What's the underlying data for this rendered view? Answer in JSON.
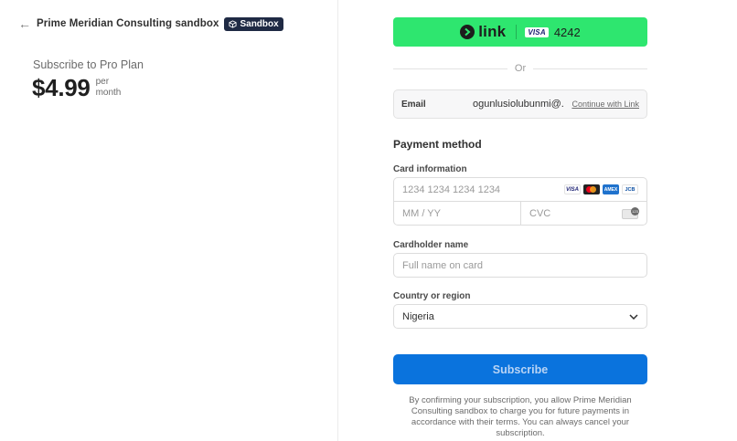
{
  "header": {
    "back_glyph": "←",
    "merchant_name": "Prime Meridian Consulting sandbox",
    "badge_label": "Sandbox"
  },
  "summary": {
    "title": "Subscribe to Pro Plan",
    "price": "$4.99",
    "per_line1": "per",
    "per_line2": "month"
  },
  "link_button": {
    "logo_text": "link",
    "card_brand": "VISA",
    "last4": "4242",
    "color": "#2ee66f"
  },
  "divider": {
    "text": "Or"
  },
  "email": {
    "label": "Email",
    "value": "ogunlusiolubunmi@...",
    "action": "Continue with Link"
  },
  "payment": {
    "section_title": "Payment method",
    "card_label": "Card information",
    "card_number_placeholder": "1234 1234 1234 1234",
    "expiry_placeholder": "MM / YY",
    "cvc_placeholder": "CVC",
    "brands": [
      "VISA",
      "Mastercard",
      "AMEX",
      "JCB"
    ],
    "cardholder_label": "Cardholder name",
    "cardholder_placeholder": "Full name on card",
    "country_label": "Country or region",
    "country_value": "Nigeria"
  },
  "submit": {
    "label": "Subscribe",
    "color": "#0a73dd"
  },
  "consent": {
    "text": "By confirming your subscription, you allow Prime Meridian Consulting sandbox to charge you for future payments in accordance with their terms. You can always cancel your subscription."
  }
}
